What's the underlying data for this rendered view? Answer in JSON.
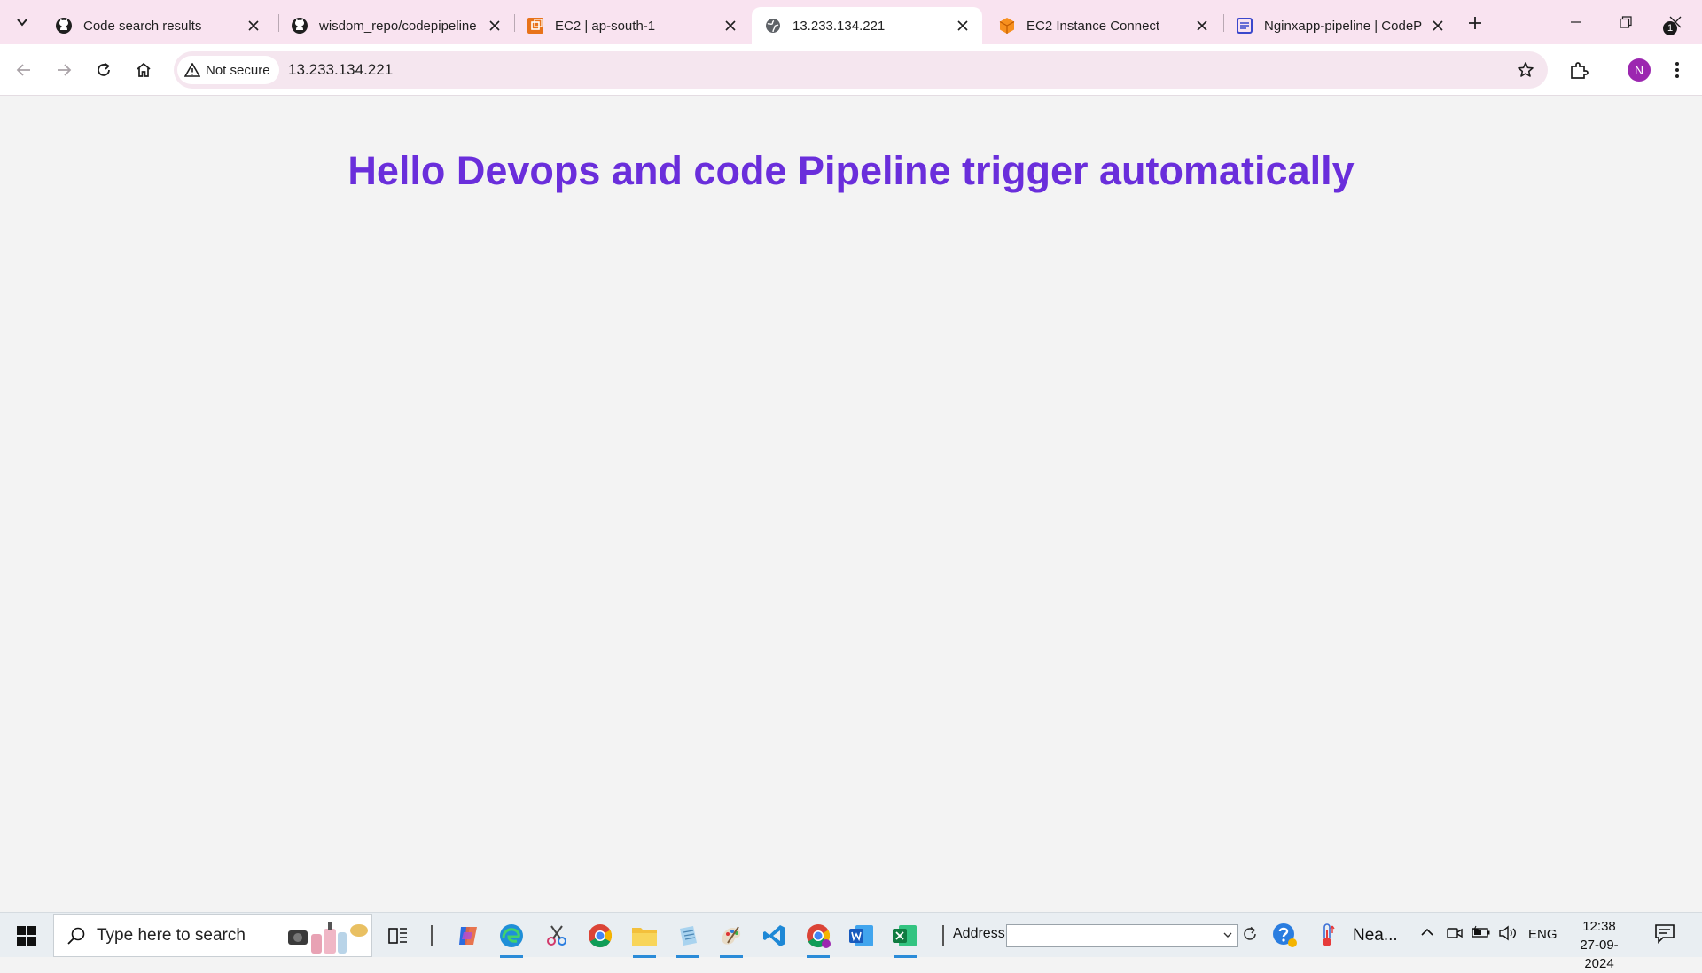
{
  "browser": {
    "tabs": [
      {
        "title": "Code search results",
        "favicon": "github-icon",
        "active": false
      },
      {
        "title": "wisdom_repo/codepipeline",
        "favicon": "github-icon",
        "active": false
      },
      {
        "title": "EC2 | ap-south-1",
        "favicon": "aws-ec2-icon",
        "active": false
      },
      {
        "title": "13.233.134.221",
        "favicon": "globe-icon",
        "active": true
      },
      {
        "title": "EC2 Instance Connect",
        "favicon": "aws-cube-icon",
        "active": false
      },
      {
        "title": "Nginxapp-pipeline | CodeP",
        "favicon": "aws-codepipeline-icon",
        "active": false
      }
    ],
    "security_label": "Not secure",
    "url": "13.233.134.221",
    "profile_initial": "N"
  },
  "page": {
    "heading": "Hello Devops and code Pipeline trigger automatically",
    "heading_color": "#6a2edb"
  },
  "taskbar": {
    "search_placeholder": "Type here to search",
    "address_label": "Address",
    "weather_text": "Nea...",
    "language": "ENG",
    "time": "12:38",
    "date": "27-09-2024",
    "notification_count": "1"
  }
}
